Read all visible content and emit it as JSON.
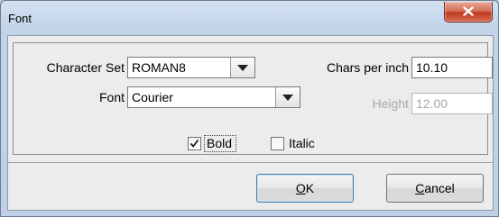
{
  "window": {
    "title": "Font"
  },
  "form": {
    "character_set": {
      "label": "Character Set",
      "value": "ROMAN8"
    },
    "font": {
      "label": "Font",
      "value": "Courier"
    },
    "chars_per_inch": {
      "label": "Chars per inch",
      "value": "10.10"
    },
    "height": {
      "label": "Height",
      "value": "12.00",
      "enabled": false
    },
    "bold": {
      "label": "Bold",
      "checked": true
    },
    "italic": {
      "label": "Italic",
      "checked": false
    }
  },
  "buttons": {
    "ok": {
      "mnemonic": "O",
      "rest": "K"
    },
    "cancel": {
      "mnemonic": "C",
      "rest": "ancel"
    }
  },
  "icons": {
    "close": "close-icon",
    "dropdown": "chevron-down-icon",
    "check": "check-icon"
  },
  "colors": {
    "close_button": "#c23b20",
    "default_button_border": "#3c7fb1",
    "disabled_text": "#a8a8a8"
  }
}
